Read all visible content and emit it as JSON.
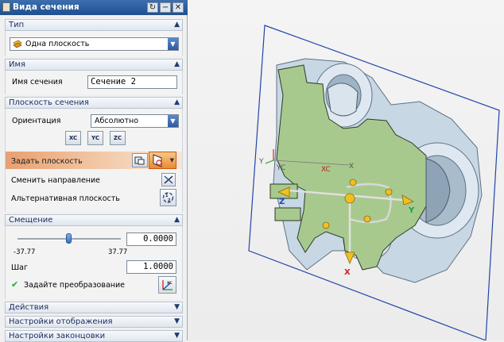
{
  "dialog": {
    "title": "Вида сечения",
    "controls": {
      "reset": "↻",
      "minimize": "−",
      "close": "✕"
    }
  },
  "sections": {
    "type": {
      "label": "Тип",
      "selected": "Одна плоскость"
    },
    "name": {
      "label": "Имя",
      "field_label": "Имя сечения",
      "value": "Сечение 2"
    },
    "plane": {
      "label": "Плоскость сечения",
      "orientation_label": "Ориентация",
      "orientation_value": "Абсолютно",
      "axis_buttons": [
        "XC",
        "YC",
        "ZC"
      ],
      "specify_plane": "Задать плоскость",
      "flip_direction": "Сменить направление",
      "alternate_plane": "Альтернативная плоскость"
    },
    "offset": {
      "label": "Смещение",
      "value": "0.0000",
      "slider_min": "-37.77",
      "slider_max": "37.77",
      "slider_position": 0.5,
      "step_label": "Шаг",
      "step_value": "1.0000",
      "transform_label": "Задайте преобразование"
    },
    "actions": {
      "label": "Действия"
    },
    "display": {
      "label": "Настройки отображения"
    },
    "cap": {
      "label": "Настройки законцовки"
    }
  },
  "viewport": {
    "axis_labels": {
      "x": "X",
      "y": "Y",
      "z": "Z",
      "xc": "XC",
      "yc": "YC"
    },
    "colors": {
      "section_fill": "#a8c98e",
      "part_body": "#c7d7e4",
      "plane_edge": "#2244aa",
      "handle_yellow": "#f0c020"
    }
  },
  "colors": {
    "titlebar": "#1f4f8e",
    "accent_highlight": "#e8a070",
    "check_green": "#22aa22"
  }
}
